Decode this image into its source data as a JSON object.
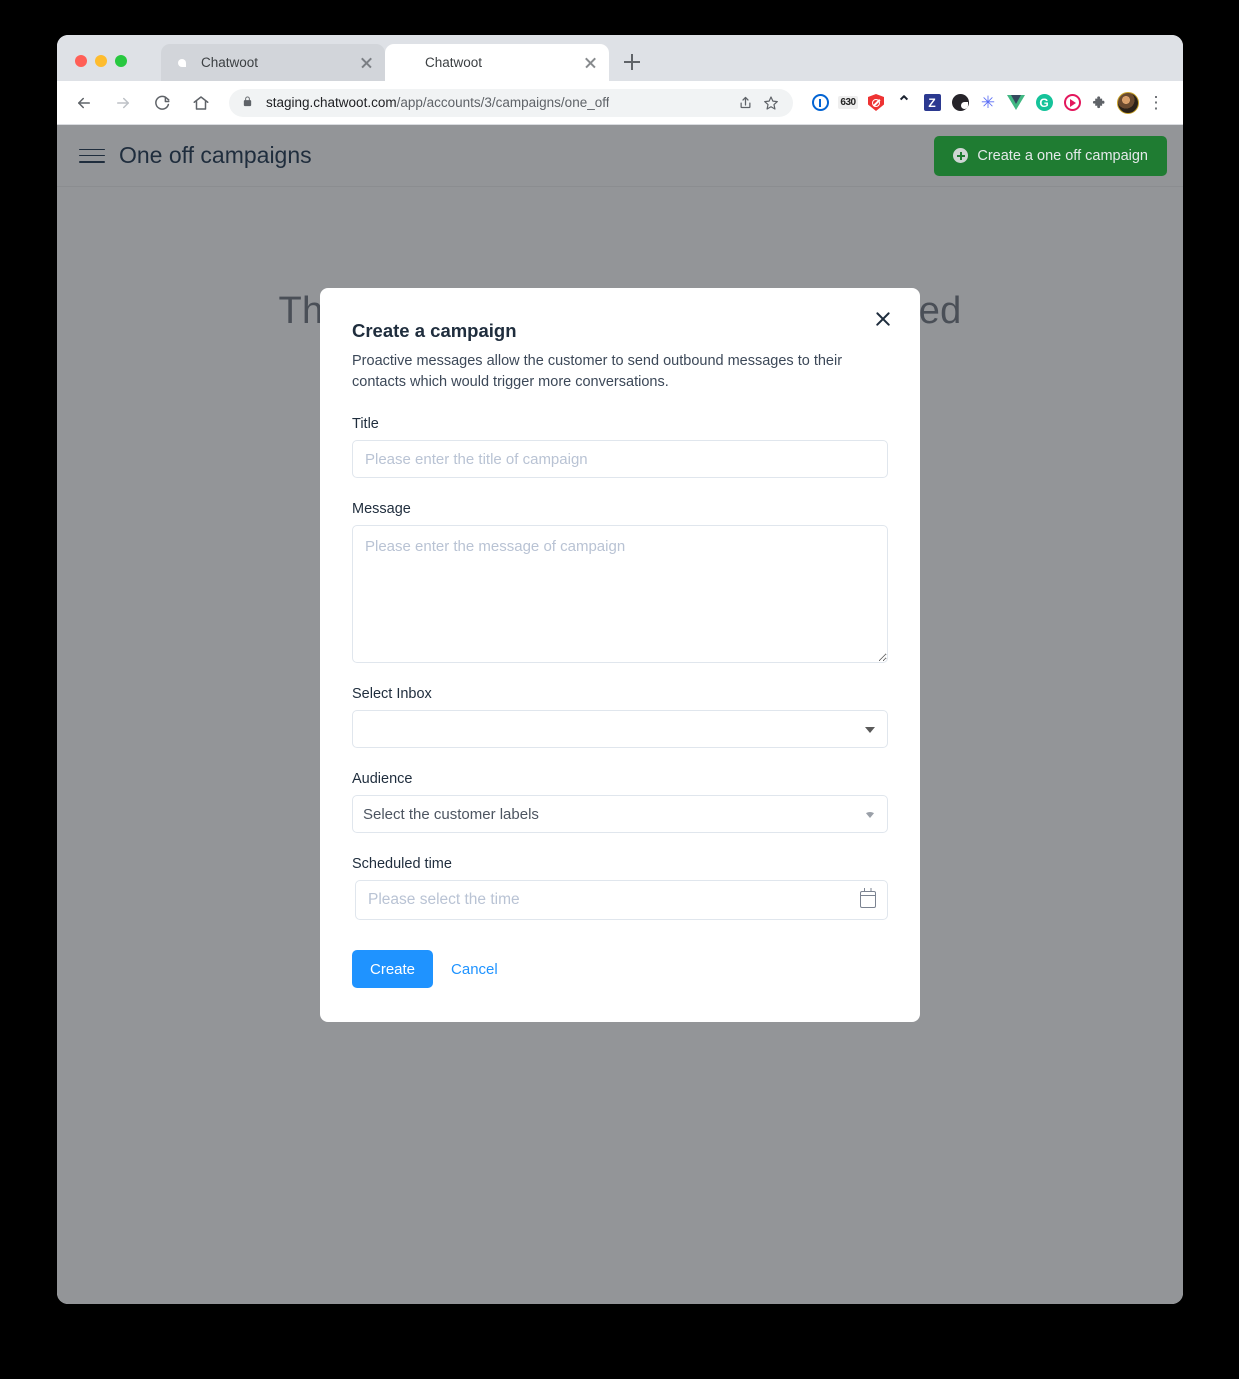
{
  "browser": {
    "tabs": [
      {
        "title": "Chatwoot",
        "favicon": "chatwoot-logo-icon",
        "active": false
      },
      {
        "title": "Chatwoot",
        "favicon": "chatwoot-logo-icon",
        "active": true
      }
    ],
    "new_tab_label": "+",
    "url_domain": "staging.chatwoot.com",
    "url_path": "/app/accounts/3/campaigns/one_off",
    "extensions": [
      "1password-icon",
      "go-links-icon",
      "shield-blocker-icon",
      "caret-up-icon",
      "zotero-icon",
      "dark-circle-icon",
      "asterisk-icon",
      "vue-devtools-icon",
      "grammarly-icon",
      "play-circle-icon",
      "puzzle-extensions-icon"
    ],
    "menu_icon": "kebab-menu-icon"
  },
  "app": {
    "header": {
      "menu_icon": "hamburger-menu-icon",
      "title": "One off campaigns",
      "primary_button": {
        "label": "Create a one off campaign",
        "icon": "plus-circle-icon",
        "color": "#1f7c32"
      }
    },
    "empty_state": "There are no one off campaigns created"
  },
  "modal": {
    "title": "Create a campaign",
    "description": "Proactive messages allow the customer to send outbound messages to their contacts which would trigger more conversations.",
    "close_icon": "close-icon",
    "fields": {
      "title": {
        "label": "Title",
        "value": "",
        "placeholder": "Please enter the title of campaign"
      },
      "message": {
        "label": "Message",
        "value": "",
        "placeholder": "Please enter the message of campaign"
      },
      "inbox": {
        "label": "Select Inbox",
        "value": "",
        "options": [
          ""
        ]
      },
      "audience": {
        "label": "Audience",
        "value": "Select the customer labels",
        "options": [
          "Select the customer labels"
        ]
      },
      "scheduled_time": {
        "label": "Scheduled time",
        "value": "",
        "placeholder": "Please select the time",
        "icon": "calendar-icon"
      }
    },
    "actions": {
      "submit_label": "Create",
      "cancel_label": "Cancel",
      "submit_color": "#1f93ff"
    }
  }
}
